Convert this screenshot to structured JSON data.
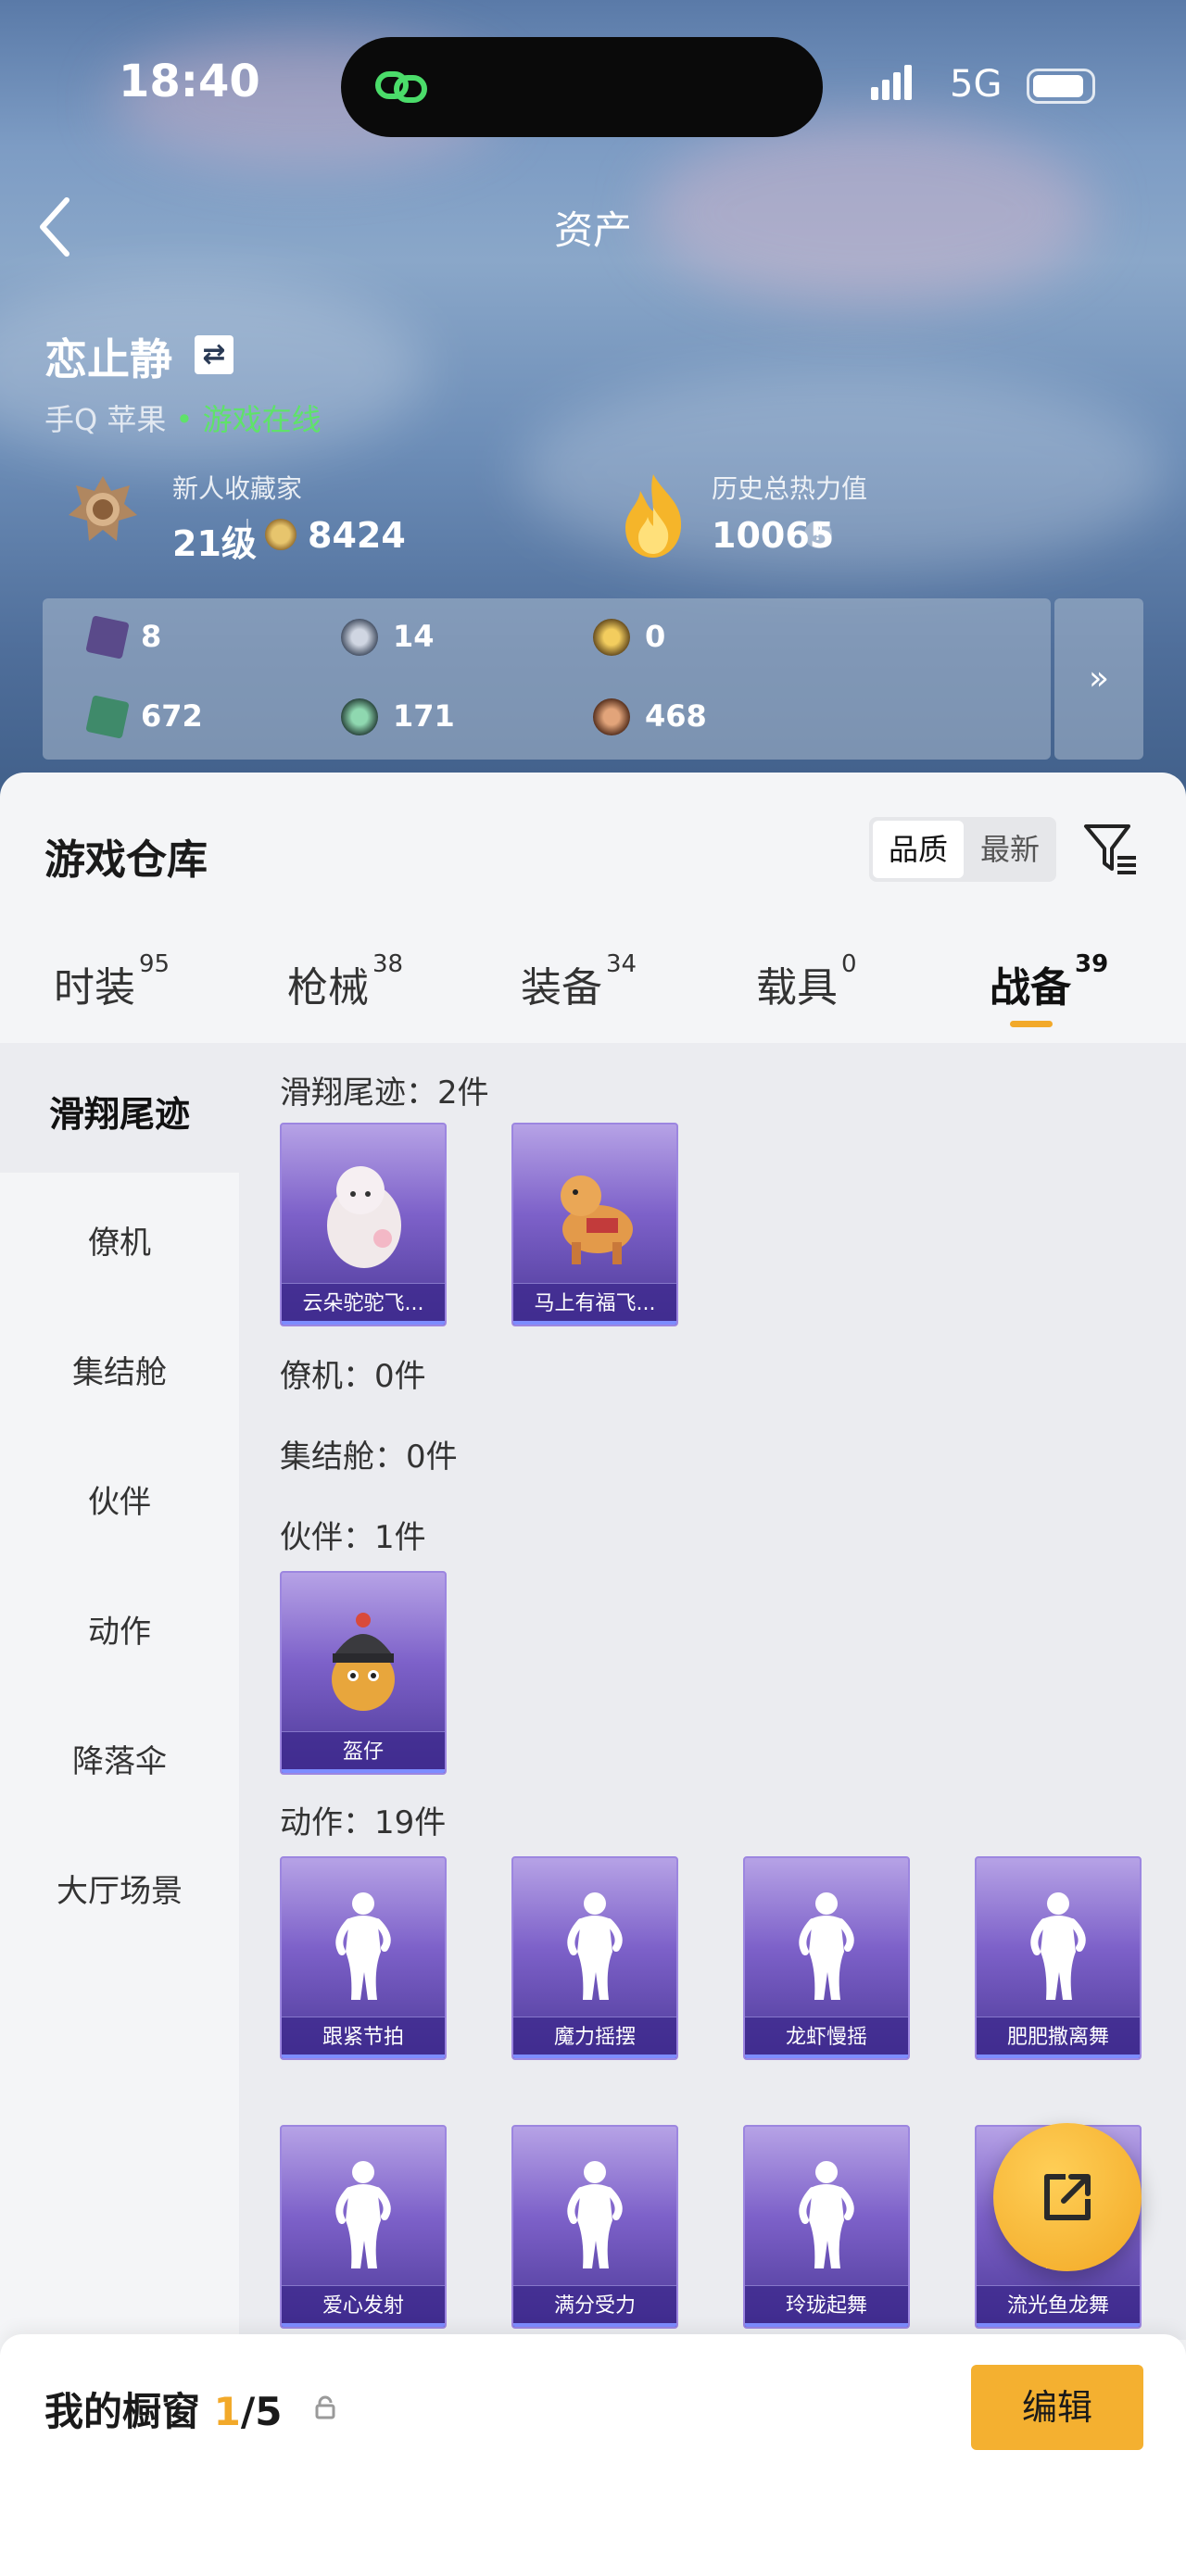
{
  "status_bar": {
    "time": "18:40",
    "network": "5G"
  },
  "header": {
    "title": "资产"
  },
  "profile": {
    "name": "恋止静",
    "platform": "手Q 苹果",
    "online_status": "• 游戏在线",
    "collector_title": "新人收藏家",
    "level": "21级",
    "coins": "8424",
    "heat_label": "历史总热力值",
    "heat_value": "10065"
  },
  "resources": [
    {
      "icon": "purple-card-icon",
      "value": "8"
    },
    {
      "icon": "silver-coin-icon",
      "value": "14"
    },
    {
      "icon": "gold-coin-icon",
      "value": "0"
    },
    {
      "icon": "green-card-icon",
      "value": "672"
    },
    {
      "icon": "jade-coin-icon",
      "value": "171"
    },
    {
      "icon": "bronze-coin-icon",
      "value": "468"
    }
  ],
  "warehouse": {
    "title": "游戏仓库",
    "sort_options": [
      "品质",
      "最新"
    ],
    "active_sort": "品质"
  },
  "tabs": [
    {
      "label": "时装",
      "count": "95"
    },
    {
      "label": "枪械",
      "count": "38"
    },
    {
      "label": "装备",
      "count": "34"
    },
    {
      "label": "载具",
      "count": "0"
    },
    {
      "label": "战备",
      "count": "39",
      "active": true
    }
  ],
  "sidebar": [
    "滑翔尾迹",
    "僚机",
    "集结舱",
    "伙伴",
    "动作",
    "降落伞",
    "大厅场景"
  ],
  "sections": {
    "glide_trail": {
      "header": "滑翔尾迹：2件",
      "items": [
        "云朵驼驼飞...",
        "马上有福飞..."
      ]
    },
    "wingman": {
      "header": "僚机：0件"
    },
    "assembly_pod": {
      "header": "集结舱：0件"
    },
    "partner": {
      "header": "伙伴：1件",
      "items": [
        "盔仔"
      ]
    },
    "emote": {
      "header": "动作：19件",
      "items": [
        "跟紧节拍",
        "魔力摇摆",
        "龙虾慢摇",
        "肥肥撒离舞",
        "爱心发射",
        "满分受力",
        "玲珑起舞",
        "流光鱼龙舞"
      ]
    }
  },
  "showcase": {
    "label": "我的橱窗",
    "current": "1",
    "total": "/5",
    "edit_label": "编辑"
  },
  "colors": {
    "accent": "#f2a92a",
    "online": "#5fe26a",
    "card": "#7d61c9"
  }
}
